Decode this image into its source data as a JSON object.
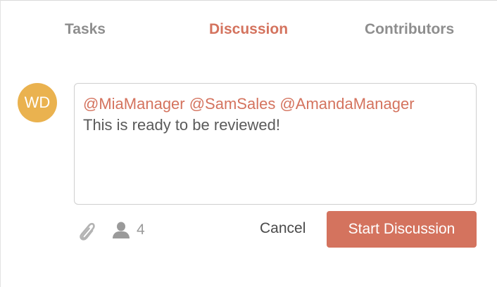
{
  "tabs": {
    "tasks": "Tasks",
    "discussion": "Discussion",
    "contributors": "Contributors",
    "active": "discussion"
  },
  "avatar": {
    "initials": "WD",
    "color": "#eab24f"
  },
  "compose": {
    "mentions": "@MiaManager @SamSales @AmandaManager",
    "message": "This is ready to be reviewed!"
  },
  "toolbar": {
    "attach_icon": "paperclip-icon",
    "people_icon": "person-icon",
    "people_count": "4",
    "cancel_label": "Cancel",
    "submit_label": "Start Discussion"
  },
  "colors": {
    "accent": "#d4735e",
    "tab_inactive": "#8e8e8e"
  }
}
